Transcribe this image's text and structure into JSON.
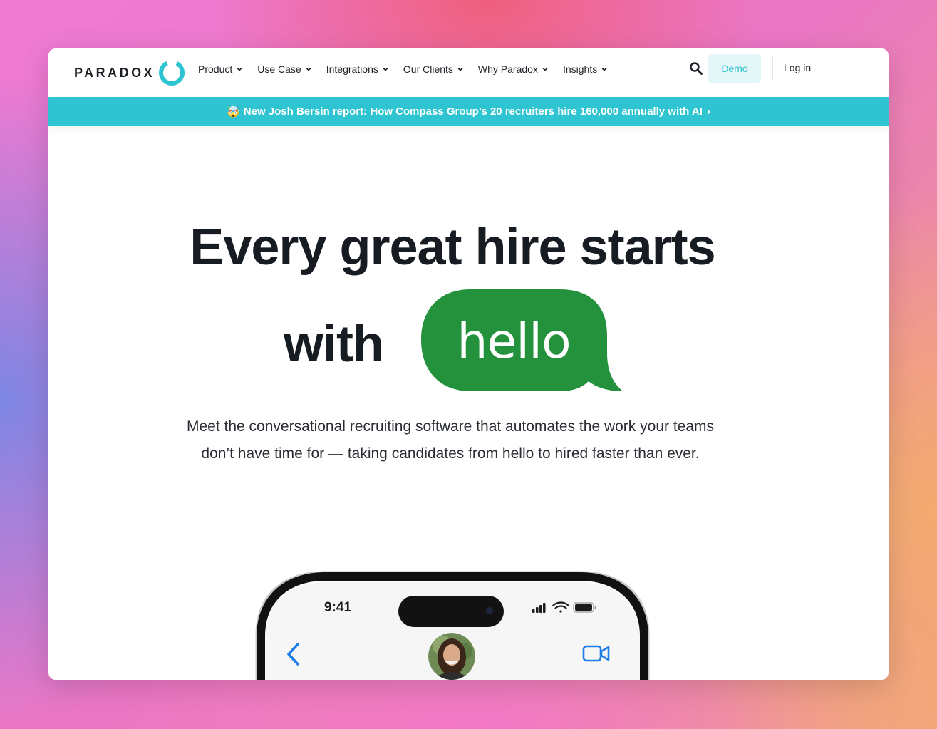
{
  "nav": {
    "logo_text": "PARADOX",
    "menu": [
      {
        "label": "Product"
      },
      {
        "label": "Use Case"
      },
      {
        "label": "Integrations"
      },
      {
        "label": "Our Clients"
      },
      {
        "label": "Why Paradox"
      },
      {
        "label": "Insights"
      }
    ],
    "demo_label": "Demo",
    "login_label": "Log in"
  },
  "banner": {
    "emoji": "🤯",
    "text": "New Josh Bersin report: How Compass Group’s 20 recruiters hire 160,000 annually with AI",
    "arrow": "›"
  },
  "hero": {
    "headline_line1": "Every great hire starts",
    "headline_with": "with",
    "bubble_word": "hello",
    "subtext": "Meet the conversational recruiting software that automates the work your teams don’t have time for — taking candidates from hello to hired faster than ever."
  },
  "phone": {
    "time": "9:41"
  },
  "colors": {
    "brand_teal": "#2ec4d2",
    "bubble_green": "#24923c",
    "demo_bg": "#e4f6f8",
    "text_dark": "#171b22"
  },
  "icons": [
    "chevron-down-icon",
    "search-icon",
    "back-chevron-icon",
    "video-call-icon",
    "signal-icon",
    "wifi-icon",
    "battery-icon"
  ]
}
